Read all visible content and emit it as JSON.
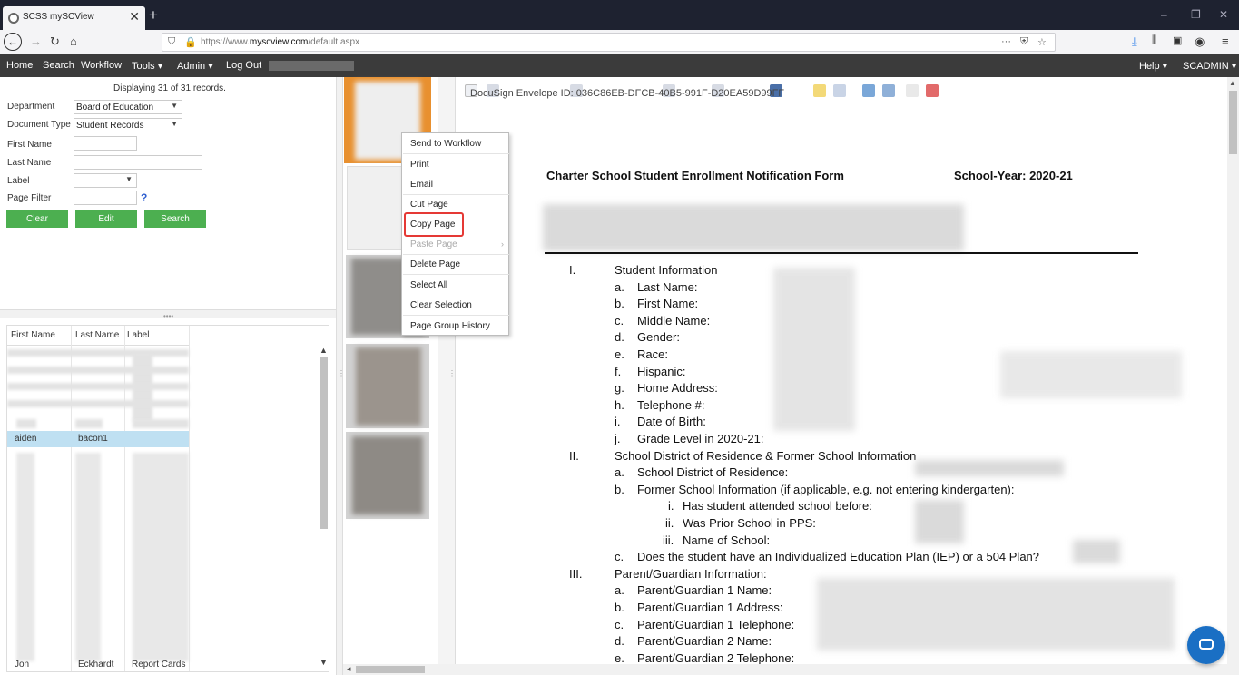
{
  "browser": {
    "tab_title": "SCSS mySCView",
    "tab_close": "✕",
    "new_tab": "+",
    "url_prefix": "https://www.",
    "url_domain": "myscview.com",
    "url_path": "/default.aspx",
    "controls": {
      "minimize": "–",
      "restore": "❐",
      "close": "✕"
    }
  },
  "appnav": {
    "items": [
      "Home",
      "Search",
      "Workflow",
      "Tools ▾",
      "Admin ▾",
      "Log Out"
    ],
    "help": "Help ▾",
    "user": "SCADMIN ▾"
  },
  "search": {
    "records_info": "Displaying 31 of 31 records.",
    "labels": {
      "department": "Department",
      "document_type": "Document Type",
      "first_name": "First Name",
      "last_name": "Last Name",
      "label": "Label",
      "page_filter": "Page Filter"
    },
    "department_value": "Board of Education",
    "document_type_value": "Student Records",
    "help": "?",
    "buttons": {
      "clear": "Clear",
      "edit": "Edit",
      "search": "Search"
    }
  },
  "results": {
    "columns": [
      "First Name",
      "Last Name",
      "Label"
    ],
    "selected_row": {
      "first": "aiden",
      "last": "bacon1",
      "label": ""
    },
    "last_row": {
      "first": "Jon",
      "last": "Eckhardt",
      "label": "Report Cards"
    }
  },
  "context_menu": {
    "items": [
      "Send to Workflow",
      "Print",
      "Email",
      "Cut Page",
      "Copy Page",
      "Paste Page",
      "Delete Page",
      "Select All",
      "Clear Selection",
      "Page Group History"
    ],
    "submenu_arrow": "›"
  },
  "document": {
    "docusign": "DocuSign Envelope ID: 036C86EB-DFCB-40B5-991F-D20EA59D99FF",
    "title": "Charter School Student Enrollment Notification Form",
    "year": "School-Year: 2020-21",
    "lines": [
      {
        "n": "I.",
        "t": "Student Information"
      },
      {
        "n": "a.",
        "t": "Last Name:"
      },
      {
        "n": "b.",
        "t": "First Name:"
      },
      {
        "n": "c.",
        "t": "Middle Name:"
      },
      {
        "n": "d.",
        "t": "Gender:"
      },
      {
        "n": "e.",
        "t": "Race:"
      },
      {
        "n": "f.",
        "t": "Hispanic:"
      },
      {
        "n": "g.",
        "t": "Home Address:"
      },
      {
        "n": "h.",
        "t": "Telephone #:"
      },
      {
        "n": "i.",
        "t": "Date of Birth:"
      },
      {
        "n": "j.",
        "t": "Grade Level in 2020-21:"
      },
      {
        "n": "II.",
        "t": "School District of Residence & Former School Information"
      },
      {
        "n": "a.",
        "t": "School District of Residence:"
      },
      {
        "n": "b.",
        "t": "Former School Information (if applicable, e.g. not entering kindergarten):"
      },
      {
        "n": "i.",
        "t": "Has student attended school before:"
      },
      {
        "n": "ii.",
        "t": "Was Prior School in PPS:"
      },
      {
        "n": "iii.",
        "t": "Name of School:"
      },
      {
        "n": "c.",
        "t": "Does the student have an Individualized Education Plan (IEP) or a 504 Plan?"
      },
      {
        "n": "III.",
        "t": "Parent/Guardian Information:"
      },
      {
        "n": "a.",
        "t": "Parent/Guardian 1 Name:"
      },
      {
        "n": "b.",
        "t": "Parent/Guardian 1 Address:"
      },
      {
        "n": "c.",
        "t": "Parent/Guardian 1 Telephone:"
      },
      {
        "n": "d.",
        "t": "Parent/Guardian 2 Name:"
      },
      {
        "n": "e.",
        "t": "Parent/Guardian 2 Telephone:"
      }
    ]
  }
}
